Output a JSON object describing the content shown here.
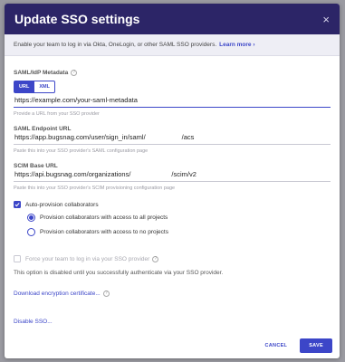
{
  "modal": {
    "title": "Update SSO settings",
    "close_glyph": "×"
  },
  "intro": {
    "text": "Enable your team to log in via Okta, OneLogin, or other SAML SSO providers.",
    "learn_more": "Learn more ›"
  },
  "metadata": {
    "label": "SAML/IdP Metadata",
    "help_glyph": "?",
    "mode_options": [
      "URL",
      "XML"
    ],
    "selected_mode": "URL",
    "value": "https://example.com/your-saml-metadata",
    "hint": "Provide a URL from your SSO provider"
  },
  "saml_endpoint": {
    "label": "SAML Endpoint URL",
    "value_prefix": "https://app.bugsnag.com/user/sign_in/saml/",
    "value_suffix": "/acs",
    "hint": "Paste this into your SSO provider's SAML configuration page"
  },
  "scim_base": {
    "label": "SCIM Base URL",
    "value_prefix": "https://api.bugsnag.com/organizations/",
    "value_suffix": "/scim/v2",
    "hint": "Paste this into your SSO provider's SCIM provisioning configuration page"
  },
  "auto_provision": {
    "label": "Auto-provision collaborators",
    "checked": true,
    "options": [
      {
        "label": "Provision collaborators with access to all projects",
        "selected": true
      },
      {
        "label": "Provision collaborators with access to no projects",
        "selected": false
      }
    ]
  },
  "force_sso": {
    "label": "Force your team to log in via your SSO provider",
    "checked": false,
    "disabled": true,
    "note": "This option is disabled until you successfully authenticate via your SSO provider."
  },
  "links": {
    "download_cert": "Download encryption certificate...",
    "disable_sso": "Disable SSO..."
  },
  "footer": {
    "cancel_label": "CANCEL",
    "save_label": "SAVE"
  },
  "colors": {
    "header_bg": "#2c2567",
    "accent": "#3c46c8",
    "backdrop": "#9a9aa1"
  },
  "icons": {
    "close": "close-icon",
    "help": "help-icon",
    "check": "check-icon"
  }
}
